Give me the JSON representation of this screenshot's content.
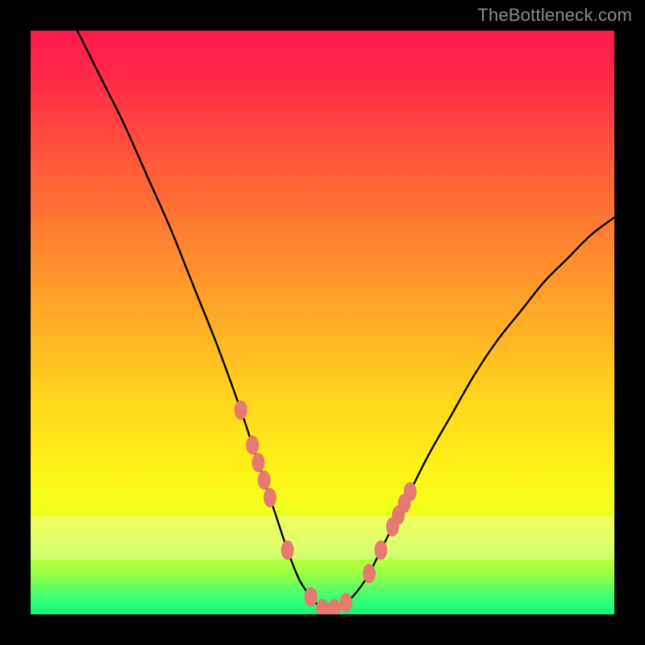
{
  "watermark": "TheBottleneck.com",
  "chart_data": {
    "type": "line",
    "title": "",
    "xlabel": "",
    "ylabel": "",
    "xlim": [
      0,
      100
    ],
    "ylim": [
      0,
      100
    ],
    "grid": false,
    "legend": false,
    "series": [
      {
        "name": "bottleneck-curve",
        "x": [
          8,
          12,
          16,
          20,
          24,
          28,
          32,
          36,
          38,
          40,
          42,
          44,
          46,
          48,
          50,
          52,
          54,
          56,
          58,
          60,
          64,
          68,
          72,
          76,
          80,
          84,
          88,
          92,
          96,
          100
        ],
        "y": [
          100,
          92,
          84,
          75,
          66,
          56,
          46,
          35,
          29,
          23,
          17,
          11,
          6,
          3,
          1,
          1,
          2,
          4,
          7,
          11,
          19,
          27,
          34,
          41,
          47,
          52,
          57,
          61,
          65,
          68
        ]
      }
    ],
    "markers": {
      "name": "highlight-dots",
      "color": "#e47a70",
      "points": [
        {
          "x": 36,
          "y": 35
        },
        {
          "x": 38,
          "y": 29
        },
        {
          "x": 39,
          "y": 26
        },
        {
          "x": 40,
          "y": 23
        },
        {
          "x": 41,
          "y": 20
        },
        {
          "x": 44,
          "y": 11
        },
        {
          "x": 48,
          "y": 3
        },
        {
          "x": 50,
          "y": 1
        },
        {
          "x": 52,
          "y": 1
        },
        {
          "x": 54,
          "y": 2
        },
        {
          "x": 58,
          "y": 7
        },
        {
          "x": 60,
          "y": 11
        },
        {
          "x": 62,
          "y": 15
        },
        {
          "x": 63,
          "y": 17
        },
        {
          "x": 64,
          "y": 19
        },
        {
          "x": 65,
          "y": 21
        }
      ]
    }
  }
}
